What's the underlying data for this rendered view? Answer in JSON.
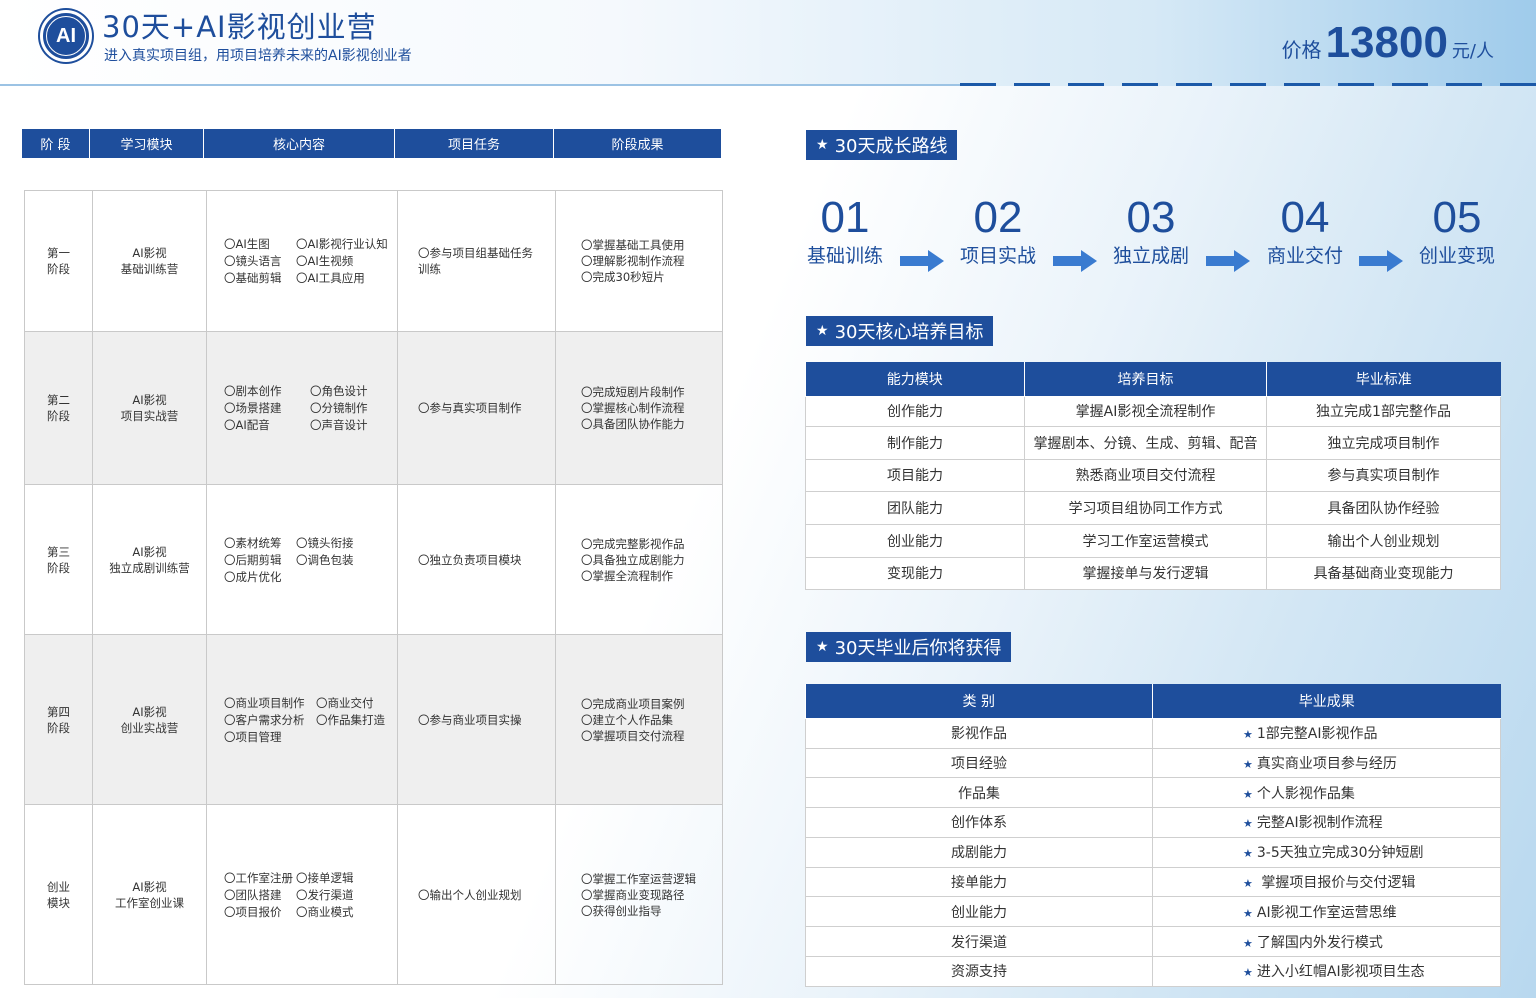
{
  "header": {
    "logo_text": "AI",
    "title": "30天+AI影视创业营",
    "subtitle": "进入真实项目组，用项目培养未来的AI影视创业者",
    "price_label": "价格",
    "price_value": "13800",
    "price_unit": "元/人"
  },
  "colors": {
    "brand": "#1e4e9c",
    "row_alt": "#efefef",
    "border": "#c9c9c9"
  },
  "left_table": {
    "headers": [
      "阶 段",
      "学习模块",
      "核心内容",
      "项目任务",
      "阶段成果"
    ],
    "rows": [
      {
        "stage": [
          "第一",
          "阶段"
        ],
        "module": [
          "AI影视",
          "基础训练营"
        ],
        "content": [
          "〇AI生图",
          "〇AI影视行业认知",
          "〇镜头语言",
          "〇AI生视频",
          "〇基础剪辑",
          "〇AI工具应用"
        ],
        "task": [
          "〇参与项目组基础任务",
          "训练"
        ],
        "result": [
          "〇掌握基础工具使用",
          "〇理解影视制作流程",
          "〇完成30秒短片"
        ]
      },
      {
        "stage": [
          "第二",
          "阶段"
        ],
        "module": [
          "AI影视",
          "项目实战营"
        ],
        "content": [
          "〇剧本创作",
          "〇角色设计",
          "〇场景搭建",
          "〇分镜制作",
          "〇AI配音",
          "〇声音设计"
        ],
        "task": [
          "〇参与真实项目制作"
        ],
        "result": [
          "〇完成短剧片段制作",
          "〇掌握核心制作流程",
          "〇具备团队协作能力"
        ]
      },
      {
        "stage": [
          "第三",
          "阶段"
        ],
        "module": [
          "AI影视",
          "独立成剧训练营"
        ],
        "content": [
          "〇素材统筹",
          "〇镜头衔接",
          "〇后期剪辑",
          "〇调色包装",
          "〇成片优化",
          ""
        ],
        "task": [
          "〇独立负责项目模块"
        ],
        "result": [
          "〇完成完整影视作品",
          "〇具备独立成剧能力",
          "〇掌握全流程制作"
        ]
      },
      {
        "stage": [
          "第四",
          "阶段"
        ],
        "module": [
          "AI影视",
          "创业实战营"
        ],
        "content": [
          "〇商业项目制作",
          "〇商业交付",
          "〇客户需求分析",
          "〇作品集打造",
          "〇项目管理",
          ""
        ],
        "task": [
          "〇参与商业项目实操"
        ],
        "result": [
          "〇完成商业项目案例",
          "〇建立个人作品集",
          "〇掌握项目交付流程"
        ]
      },
      {
        "stage": [
          "创业",
          "模块"
        ],
        "module": [
          "AI影视",
          "工作室创业课"
        ],
        "content": [
          "〇工作室注册",
          "〇接单逻辑",
          "〇团队搭建",
          "〇发行渠道",
          "〇项目报价",
          "〇商业模式"
        ],
        "task": [
          "〇输出个人创业规划"
        ],
        "result": [
          "〇掌握工作室运营逻辑",
          "〇掌握商业变现路径",
          "〇获得创业指导"
        ]
      }
    ]
  },
  "growth": {
    "section_title": "30天成长路线",
    "steps": [
      {
        "num": "01",
        "label": "基础训练"
      },
      {
        "num": "02",
        "label": "项目实战"
      },
      {
        "num": "03",
        "label": "独立成剧"
      },
      {
        "num": "04",
        "label": "商业交付"
      },
      {
        "num": "05",
        "label": "创业变现"
      }
    ]
  },
  "goals": {
    "section_title": "30天核心培养目标",
    "headers": [
      "能力模块",
      "培养目标",
      "毕业标准"
    ],
    "rows": [
      [
        "创作能力",
        "掌握AI影视全流程制作",
        "独立完成1部完整作品"
      ],
      [
        "制作能力",
        "掌握剧本、分镜、生成、剪辑、配音",
        "独立完成项目制作"
      ],
      [
        "项目能力",
        "熟悉商业项目交付流程",
        "参与真实项目制作"
      ],
      [
        "团队能力",
        "学习项目组协同工作方式",
        "具备团队协作经验"
      ],
      [
        "创业能力",
        "学习工作室运营模式",
        "输出个人创业规划"
      ],
      [
        "变现能力",
        "掌握接单与发行逻辑",
        "具备基础商业变现能力"
      ]
    ]
  },
  "gains": {
    "section_title": "30天毕业后你将获得",
    "headers": [
      "类 别",
      "毕业成果"
    ],
    "rows": [
      [
        "影视作品",
        "1部完整AI影视作品"
      ],
      [
        "项目经验",
        "真实商业项目参与经历"
      ],
      [
        "作品集",
        "个人影视作品集"
      ],
      [
        "创作体系",
        "完整AI影视制作流程"
      ],
      [
        "成剧能力",
        "3-5天独立完成30分钟短剧"
      ],
      [
        "接单能力",
        " 掌握项目报价与交付逻辑"
      ],
      [
        "创业能力",
        "AI影视工作室运营思维"
      ],
      [
        "发行渠道",
        "了解国内外发行模式"
      ],
      [
        "资源支持",
        "进入小红帽AI影视项目生态"
      ]
    ]
  }
}
